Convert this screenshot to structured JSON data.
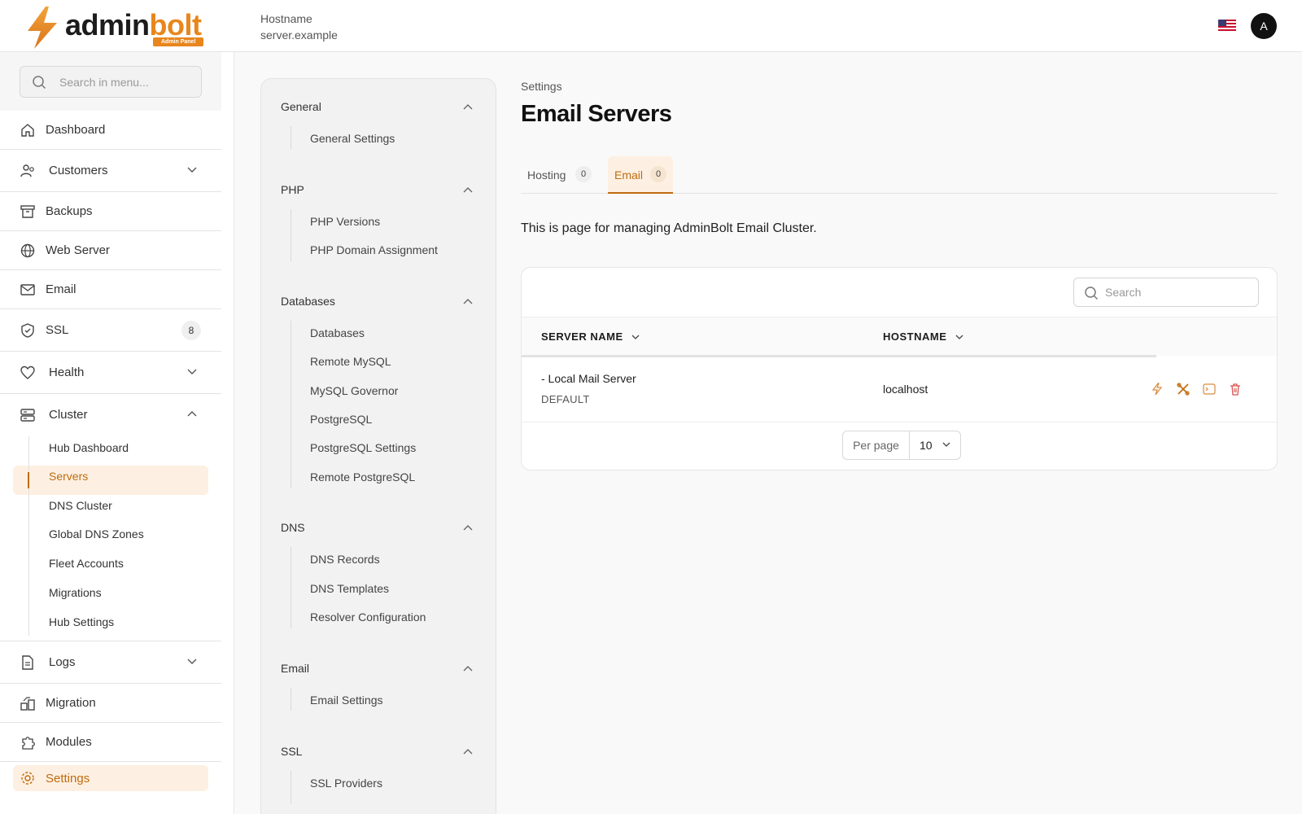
{
  "brand": {
    "name_part1": "admin",
    "name_part2": "bolt",
    "badge": "Admin Panel",
    "accent": "#e8861c"
  },
  "header": {
    "hostname_label": "Hostname",
    "hostname_value": "server.example",
    "avatar_initial": "A"
  },
  "sidebar": {
    "search_placeholder": "Search in menu...",
    "items": [
      {
        "label": "Dashboard"
      },
      {
        "label": "Customers"
      },
      {
        "label": "Backups"
      },
      {
        "label": "Web Server"
      },
      {
        "label": "Email"
      },
      {
        "label": "SSL",
        "badge": "8"
      },
      {
        "label": "Health"
      },
      {
        "label": "Cluster"
      },
      {
        "label": "Logs"
      },
      {
        "label": "Migration"
      },
      {
        "label": "Modules"
      },
      {
        "label": "Settings"
      }
    ],
    "cluster_sub": [
      "Hub Dashboard",
      "Servers",
      "DNS Cluster",
      "Global DNS Zones",
      "Fleet Accounts",
      "Migrations",
      "Hub Settings"
    ]
  },
  "settings_nav": {
    "sections": [
      {
        "title": "General",
        "items": [
          "General Settings"
        ]
      },
      {
        "title": "PHP",
        "items": [
          "PHP Versions",
          "PHP Domain Assignment"
        ]
      },
      {
        "title": "Databases",
        "items": [
          "Databases",
          "Remote MySQL",
          "MySQL Governor",
          "PostgreSQL",
          "PostgreSQL Settings",
          "Remote PostgreSQL"
        ]
      },
      {
        "title": "DNS",
        "items": [
          "DNS Records",
          "DNS Templates",
          "Resolver Configuration"
        ]
      },
      {
        "title": "Email",
        "items": [
          "Email Settings"
        ]
      },
      {
        "title": "SSL",
        "items": [
          "SSL Providers"
        ]
      }
    ]
  },
  "main": {
    "breadcrumb": "Settings",
    "title": "Email Servers",
    "tabs": [
      {
        "label": "Hosting",
        "count": "0"
      },
      {
        "label": "Email",
        "count": "0"
      }
    ],
    "description": "This is page for managing AdminBolt Email Cluster.",
    "table": {
      "search_placeholder": "Search",
      "columns": [
        "SERVER NAME",
        "HOSTNAME"
      ],
      "rows": [
        {
          "name": "- Local Mail Server",
          "tag": "DEFAULT",
          "hostname": "localhost"
        }
      ],
      "per_page_label": "Per page",
      "per_page_value": "10"
    }
  }
}
